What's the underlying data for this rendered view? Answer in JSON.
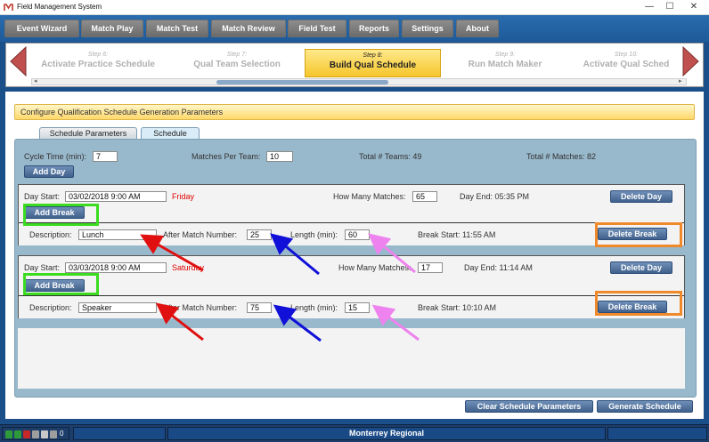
{
  "window": {
    "title": "Field Management System",
    "buttons": [
      "—",
      "☐",
      "✕"
    ]
  },
  "menu": [
    "Event Wizard",
    "Match Play",
    "Match Test",
    "Match Review",
    "Field Test",
    "Reports",
    "Settings",
    "About"
  ],
  "steps": [
    {
      "num": "Step 6:",
      "label": "Activate Practice Schedule"
    },
    {
      "num": "Step 7:",
      "label": "Qual Team Selection"
    },
    {
      "num": "Step 8:",
      "label": "Build Qual Schedule"
    },
    {
      "num": "Step 9:",
      "label": "Run Match Maker"
    },
    {
      "num": "Step 10:",
      "label": "Activate Qual Sched"
    }
  ],
  "section_header": "Configure Qualification Schedule Generation Parameters",
  "tabs": {
    "params": "Schedule Parameters",
    "schedule": "Schedule"
  },
  "params": {
    "cycle_label": "Cycle Time (min):",
    "cycle_value": "7",
    "mpt_label": "Matches Per Team:",
    "mpt_value": "10",
    "teams_text": "Total # Teams: 49",
    "matches_text": "Total # Matches: 82",
    "add_day": "Add Day"
  },
  "days": [
    {
      "day_start_label": "Day Start:",
      "day_start": "03/02/2018 9:00 AM",
      "weekday": "Friday",
      "how_many_label": "How Many Matches:",
      "how_many": "65",
      "day_end": "Day End:  05:35 PM",
      "delete_day": "Delete Day",
      "add_break": "Add Break",
      "break": {
        "desc_label": "Description:",
        "desc": "Lunch",
        "after_label": "After Match Number:",
        "after": "25",
        "length_label": "Length (min):",
        "length": "60",
        "break_start": "Break Start:  11:55 AM",
        "delete_break": "Delete Break"
      }
    },
    {
      "day_start_label": "Day Start:",
      "day_start": "03/03/2018 9:00 AM",
      "weekday": "Saturday",
      "how_many_label": "How Many Matches:",
      "how_many": "17",
      "day_end": "Day End:  11:14 AM",
      "delete_day": "Delete Day",
      "add_break": "Add Break",
      "break": {
        "desc_label": "Description:",
        "desc": "Speaker",
        "after_label": "After Match Number:",
        "after": "75",
        "length_label": "Length (min):",
        "length": "15",
        "break_start": "Break Start:  10:10 AM",
        "delete_break": "Delete Break"
      }
    }
  ],
  "footer": {
    "clear": "Clear Schedule Parameters",
    "generate": "Generate Schedule"
  },
  "status": {
    "event": "Monterrey Regional",
    "count": "0"
  },
  "colors": {
    "highlight_green": "#3bdc20",
    "highlight_orange": "#f0892a",
    "arrow_red": "#e01010",
    "arrow_blue": "#1010d8",
    "arrow_pink": "#ee82ee"
  }
}
